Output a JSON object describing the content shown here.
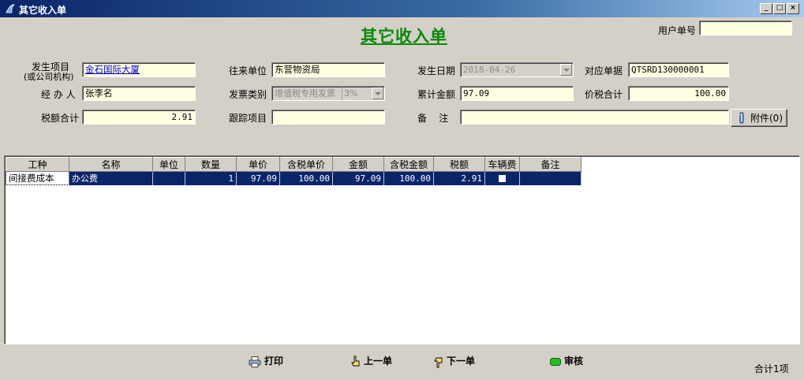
{
  "window": {
    "title": "其它收入单"
  },
  "form": {
    "title": "其它收入单",
    "user_no_label": "用户单号",
    "user_no_value": ""
  },
  "fields": {
    "project_label_1": "发生项目",
    "project_label_2": "(或公司机构)",
    "project_value": "金石国际大厦",
    "partner_label": "往来单位",
    "partner_value": "东营物资局",
    "date_label": "发生日期",
    "date_value": "2018-04-26",
    "ref_label": "对应单据",
    "ref_value": "QTSRD130000001",
    "handler_label": "经 办 人",
    "handler_value": "张李名",
    "invoice_label": "发票类别",
    "invoice_value": "增值税专用发票",
    "invoice_rate": "3%",
    "total_label": "累计金额",
    "total_value": "97.09",
    "taxtotal_label": "价税合计",
    "taxtotal_value": "100.00",
    "taxsum_label": "税额合计",
    "taxsum_value": "2.91",
    "track_label": "跟踪项目",
    "track_value": "",
    "remark_label": "备    注",
    "remark_value": "",
    "attach_label": "附件(0)"
  },
  "grid": {
    "columns": [
      "工种",
      "名称",
      "单位",
      "数量",
      "单价",
      "含税单价",
      "金额",
      "含税金额",
      "税额",
      "车辆费",
      "备注"
    ],
    "rows": [
      {
        "type": "间接费成本",
        "name": "办公费",
        "unit": "",
        "qty": "1",
        "price": "97.09",
        "tax_price": "100.00",
        "amount": "97.09",
        "tax_amount": "100.00",
        "tax": "2.91",
        "vehicle_fee": false,
        "note": ""
      }
    ]
  },
  "actions": {
    "print": "打印",
    "prev": "上一单",
    "next": "下一单",
    "audit": "审核"
  },
  "summary": "合计1项",
  "colors": {
    "accent_green": "#0a8a0a",
    "field_bg": "#ffffe1",
    "selection": "#0a246a"
  }
}
